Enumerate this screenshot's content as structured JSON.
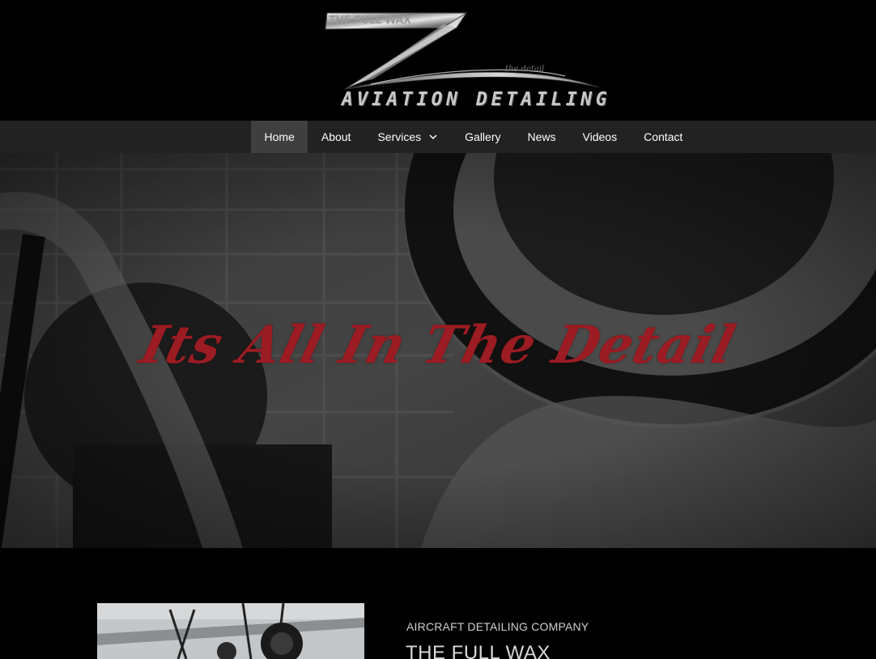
{
  "header": {
    "logo": {
      "tag": "THE FULL WAX",
      "script": "the detail",
      "wordmark": "AVIATION DETAILING"
    }
  },
  "nav": {
    "items": [
      {
        "label": "Home",
        "active": true
      },
      {
        "label": "About"
      },
      {
        "label": "Services",
        "has_dropdown": true
      },
      {
        "label": "Gallery"
      },
      {
        "label": "News"
      },
      {
        "label": "Videos"
      },
      {
        "label": "Contact"
      }
    ]
  },
  "hero": {
    "title": "Its All In The Detail",
    "title_color": "#9b1c22"
  },
  "intro": {
    "kicker": "AIRCRAFT DETAILING COMPANY",
    "heading": "THE FULL WAX"
  },
  "colors": {
    "background": "#000000",
    "nav_background": "#222222",
    "nav_active": "#3f3f3f",
    "accent_red": "#9b1c22"
  }
}
